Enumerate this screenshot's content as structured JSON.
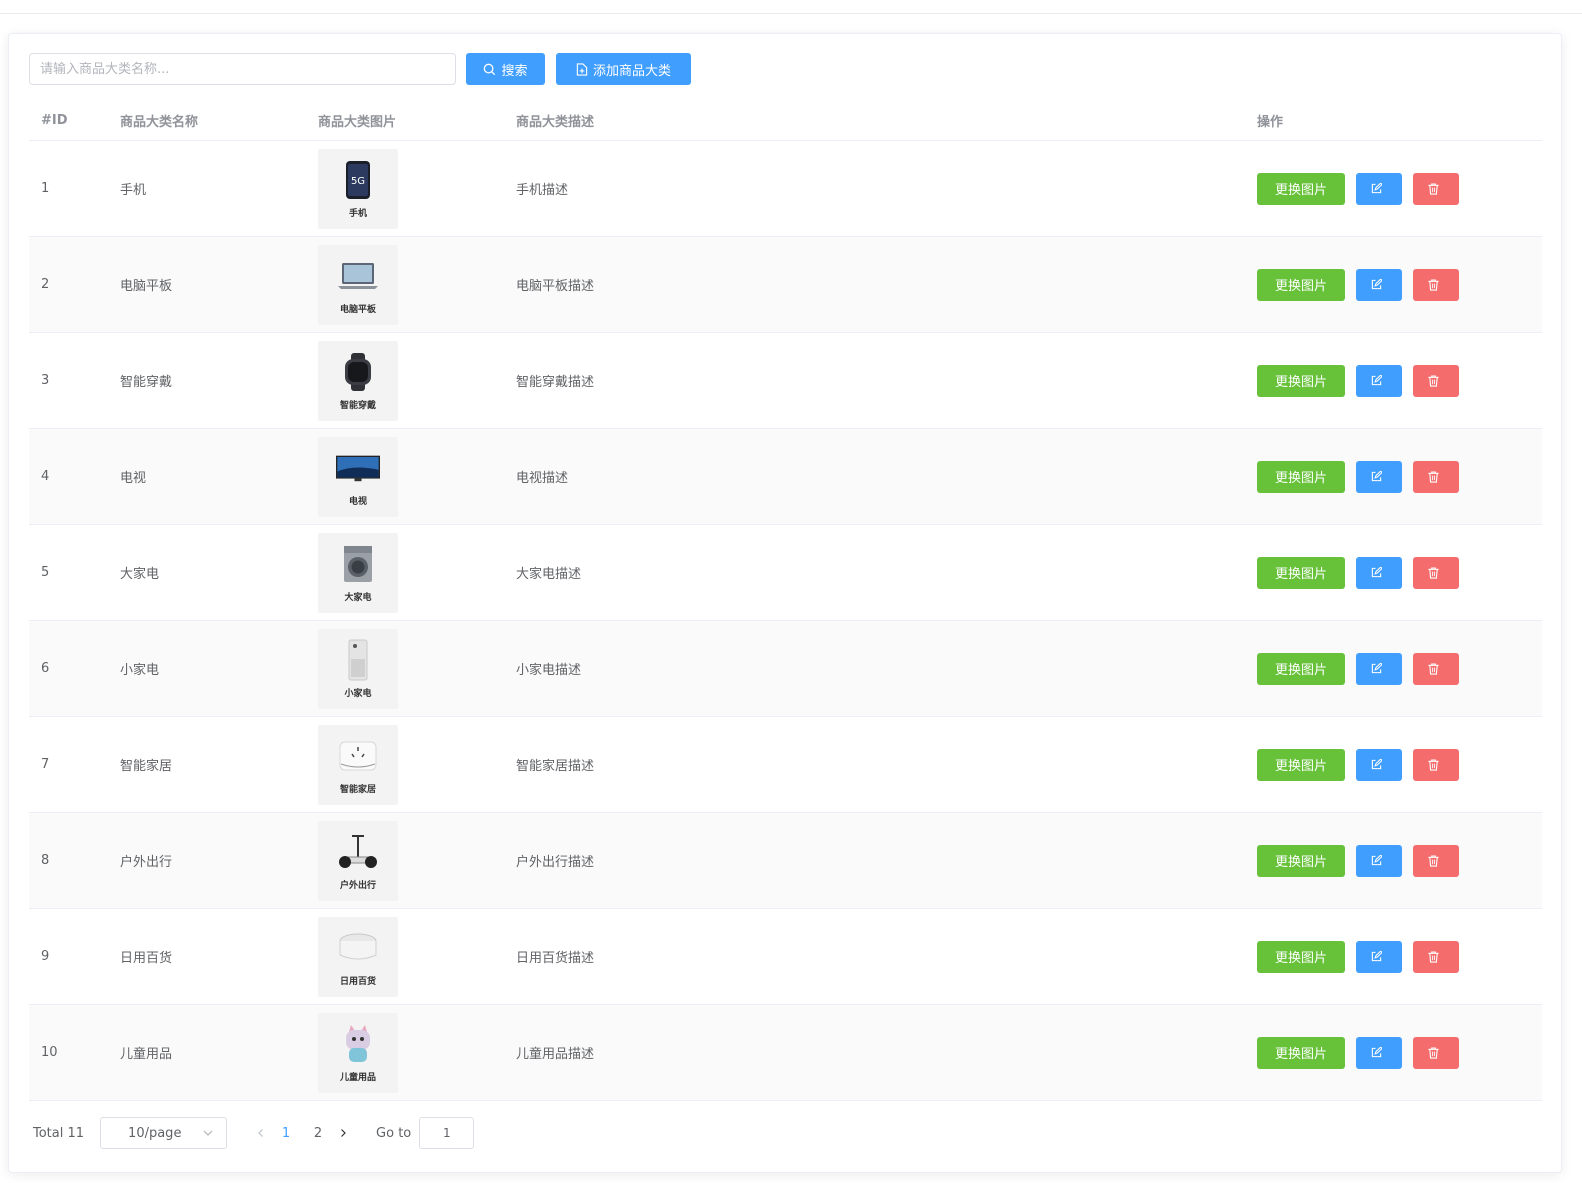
{
  "toolbar": {
    "search_placeholder": "请输入商品大类名称...",
    "search_label": "搜索",
    "add_label": "添加商品大类"
  },
  "table": {
    "headers": [
      "#ID",
      "商品大类名称",
      "商品大类图片",
      "商品大类描述",
      "操作"
    ],
    "change_image_label": "更换图片",
    "rows": [
      {
        "id": "1",
        "name": "手机",
        "image_caption": "手机",
        "desc": "手机描述",
        "icon": "phone-icon"
      },
      {
        "id": "2",
        "name": "电脑平板",
        "image_caption": "电脑平板",
        "desc": "电脑平板描述",
        "icon": "laptop-icon"
      },
      {
        "id": "3",
        "name": "智能穿戴",
        "image_caption": "智能穿戴",
        "desc": "智能穿戴描述",
        "icon": "watch-icon"
      },
      {
        "id": "4",
        "name": "电视",
        "image_caption": "电视",
        "desc": "电视描述",
        "icon": "tv-icon"
      },
      {
        "id": "5",
        "name": "大家电",
        "image_caption": "大家电",
        "desc": "大家电描述",
        "icon": "washer-icon"
      },
      {
        "id": "6",
        "name": "小家电",
        "image_caption": "小家电",
        "desc": "小家电描述",
        "icon": "air-purifier-icon"
      },
      {
        "id": "7",
        "name": "智能家居",
        "image_caption": "智能家居",
        "desc": "智能家居描述",
        "icon": "smart-home-icon"
      },
      {
        "id": "8",
        "name": "户外出行",
        "image_caption": "户外出行",
        "desc": "户外出行描述",
        "icon": "scooter-icon"
      },
      {
        "id": "9",
        "name": "日用百货",
        "image_caption": "日用百货",
        "desc": "日用百货描述",
        "icon": "daily-goods-icon"
      },
      {
        "id": "10",
        "name": "儿童用品",
        "image_caption": "儿童用品",
        "desc": "儿童用品描述",
        "icon": "kids-toy-icon"
      }
    ]
  },
  "pagination": {
    "total": "Total 11",
    "page_size": "10/page",
    "pages": [
      "1",
      "2"
    ],
    "current_page": "1",
    "goto_label": "Go to",
    "goto_value": "1"
  },
  "colors": {
    "primary": "#409eff",
    "success": "#67c23a",
    "danger": "#f56c6c"
  }
}
